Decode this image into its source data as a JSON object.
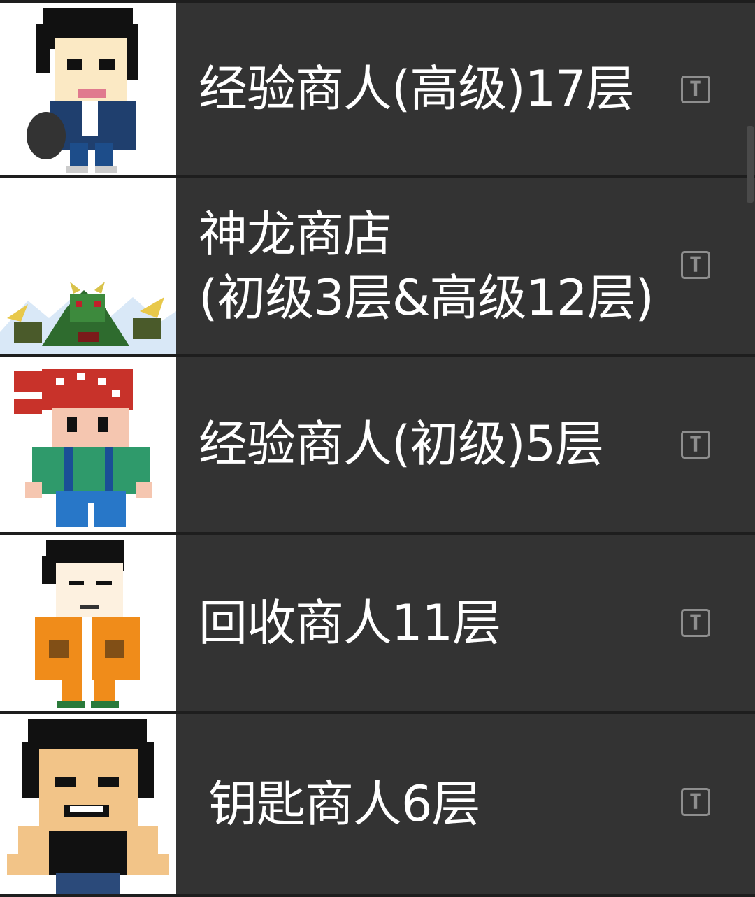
{
  "items": [
    {
      "label": "经验商人(高级)17层",
      "icon": "text-icon"
    },
    {
      "label_line1": "神龙商店",
      "label_line2": "(初级3层&高级12层)",
      "icon": "text-icon"
    },
    {
      "label": "经验商人(初级)5层",
      "icon": "text-icon"
    },
    {
      "label": "回收商人11层",
      "icon": "text-icon"
    },
    {
      "label": "钥匙商人6层",
      "icon": "text-icon"
    }
  ],
  "icon_glyph": "T",
  "colors": {
    "row_bg": "#333333",
    "text": "#ffffff",
    "icon": "#8e8e8e",
    "portrait_bg": "#ffffff"
  }
}
